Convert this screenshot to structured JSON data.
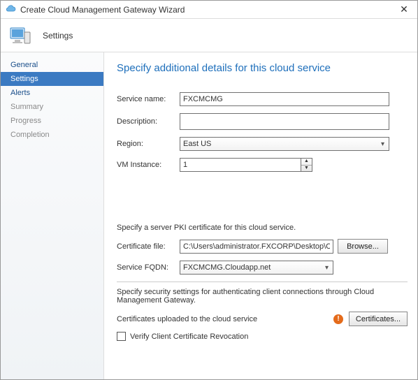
{
  "titlebar": {
    "title": "Create Cloud Management Gateway Wizard"
  },
  "header": {
    "label": "Settings"
  },
  "sidebar": {
    "items": [
      {
        "label": "General",
        "state": "done"
      },
      {
        "label": "Settings",
        "state": "active"
      },
      {
        "label": "Alerts",
        "state": "done"
      },
      {
        "label": "Summary",
        "state": "pending"
      },
      {
        "label": "Progress",
        "state": "pending"
      },
      {
        "label": "Completion",
        "state": "pending"
      }
    ]
  },
  "page": {
    "title": "Specify additional details for this cloud service",
    "service_name_label": "Service name:",
    "service_name_value": "FXCMCMG",
    "description_label": "Description:",
    "description_value": "",
    "region_label": "Region:",
    "region_value": "East US",
    "vm_label": "VM Instance:",
    "vm_value": "1",
    "pki_text": "Specify a server PKI certificate for this cloud service.",
    "certfile_label": "Certificate file:",
    "certfile_value": "C:\\Users\\administrator.FXCORP\\Desktop\\Certificates",
    "browse_label": "Browse...",
    "fqdn_label": "Service FQDN:",
    "fqdn_value": "FXCMCMG.Cloudapp.net",
    "sec_text": "Specify security settings for authenticating client connections through Cloud Management Gateway.",
    "uploaded_text": "Certificates uploaded to the cloud service",
    "certificates_label": "Certificates...",
    "verify_label": "Verify Client Certificate Revocation"
  }
}
